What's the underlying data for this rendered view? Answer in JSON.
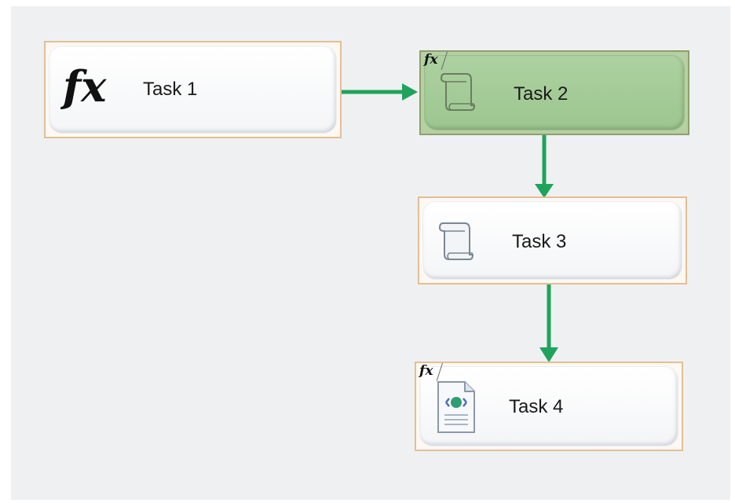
{
  "tasks": [
    {
      "label": "Task 1",
      "icon": "fx-icon",
      "selected": false
    },
    {
      "label": "Task 2",
      "icon": "script-scroll-icon",
      "badge": "fx",
      "selected": true
    },
    {
      "label": "Task 3",
      "icon": "script-scroll-icon",
      "selected": false
    },
    {
      "label": "Task 4",
      "icon": "web-service-document-icon",
      "badge": "fx",
      "selected": false
    }
  ],
  "fx_symbol": "fx",
  "colors": {
    "canvas": "#eff0f2",
    "task_border": "#e3bf95",
    "selected_fill": "#9cc68f",
    "connector": "#1fa35b"
  }
}
